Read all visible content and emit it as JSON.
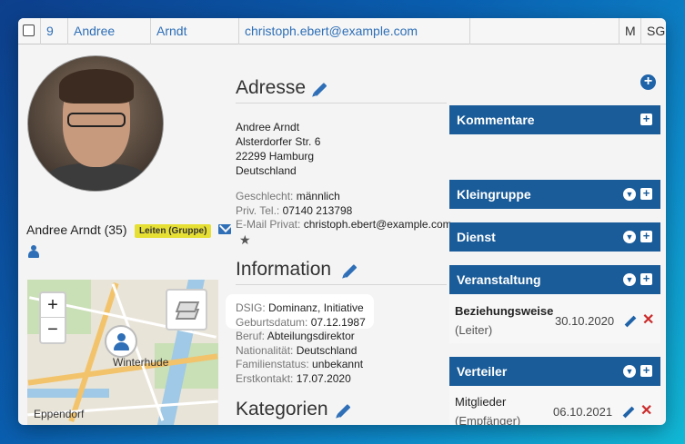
{
  "topbar": {
    "id": "9",
    "first_name": "Andree",
    "last_name": "Arndt",
    "email": "christoph.ebert@example.com",
    "col_m": "M",
    "col_sg": "SG"
  },
  "profile": {
    "name": "Andree Arndt (35)",
    "badge": "Leiten (Gruppe)"
  },
  "map": {
    "zoom_in": "+",
    "zoom_out": "−",
    "labels": {
      "district": "Winterhude",
      "area": "Eppendorf"
    }
  },
  "address": {
    "title": "Adresse",
    "lines": [
      "Andree Arndt",
      "Alsterdorfer Str. 6",
      "22299 Hamburg",
      "Deutschland"
    ],
    "gender_label": "Geschlecht:",
    "gender": "männlich",
    "phone_label": "Priv. Tel.:",
    "phone": "07140 213798",
    "email_label": "E-Mail Privat:",
    "email": "christoph.ebert@example.com"
  },
  "information": {
    "title": "Information",
    "dsig_label": "DSIG:",
    "dsig": "Dominanz, Initiative",
    "birth_label": "Geburtsdatum:",
    "birth": "07.12.1987",
    "job_label": "Beruf:",
    "job": "Abteilungsdirektor",
    "nat_label": "Nationalität:",
    "nat": "Deutschland",
    "family_label": "Familienstatus:",
    "family": "unbekannt",
    "first_label": "Erstkontakt:",
    "first": "17.07.2020"
  },
  "categories": {
    "title": "Kategorien"
  },
  "panels": {
    "kommentare": "Kommentare",
    "kleingruppe": "Kleingruppe",
    "dienst": "Dienst",
    "veranstaltung": {
      "title": "Veranstaltung",
      "item_name": "Beziehungsweise",
      "item_role": "(Leiter)",
      "item_date": "30.10.2020"
    },
    "verteiler": {
      "title": "Verteiler",
      "item_name": "Mitglieder",
      "item_role": "(Empfänger)",
      "item_date": "06.10.2021"
    }
  },
  "colors": {
    "accent": "#1a5c99",
    "link": "#2e6fb7",
    "badge": "#e6df34",
    "delete": "#cc2b2b"
  }
}
